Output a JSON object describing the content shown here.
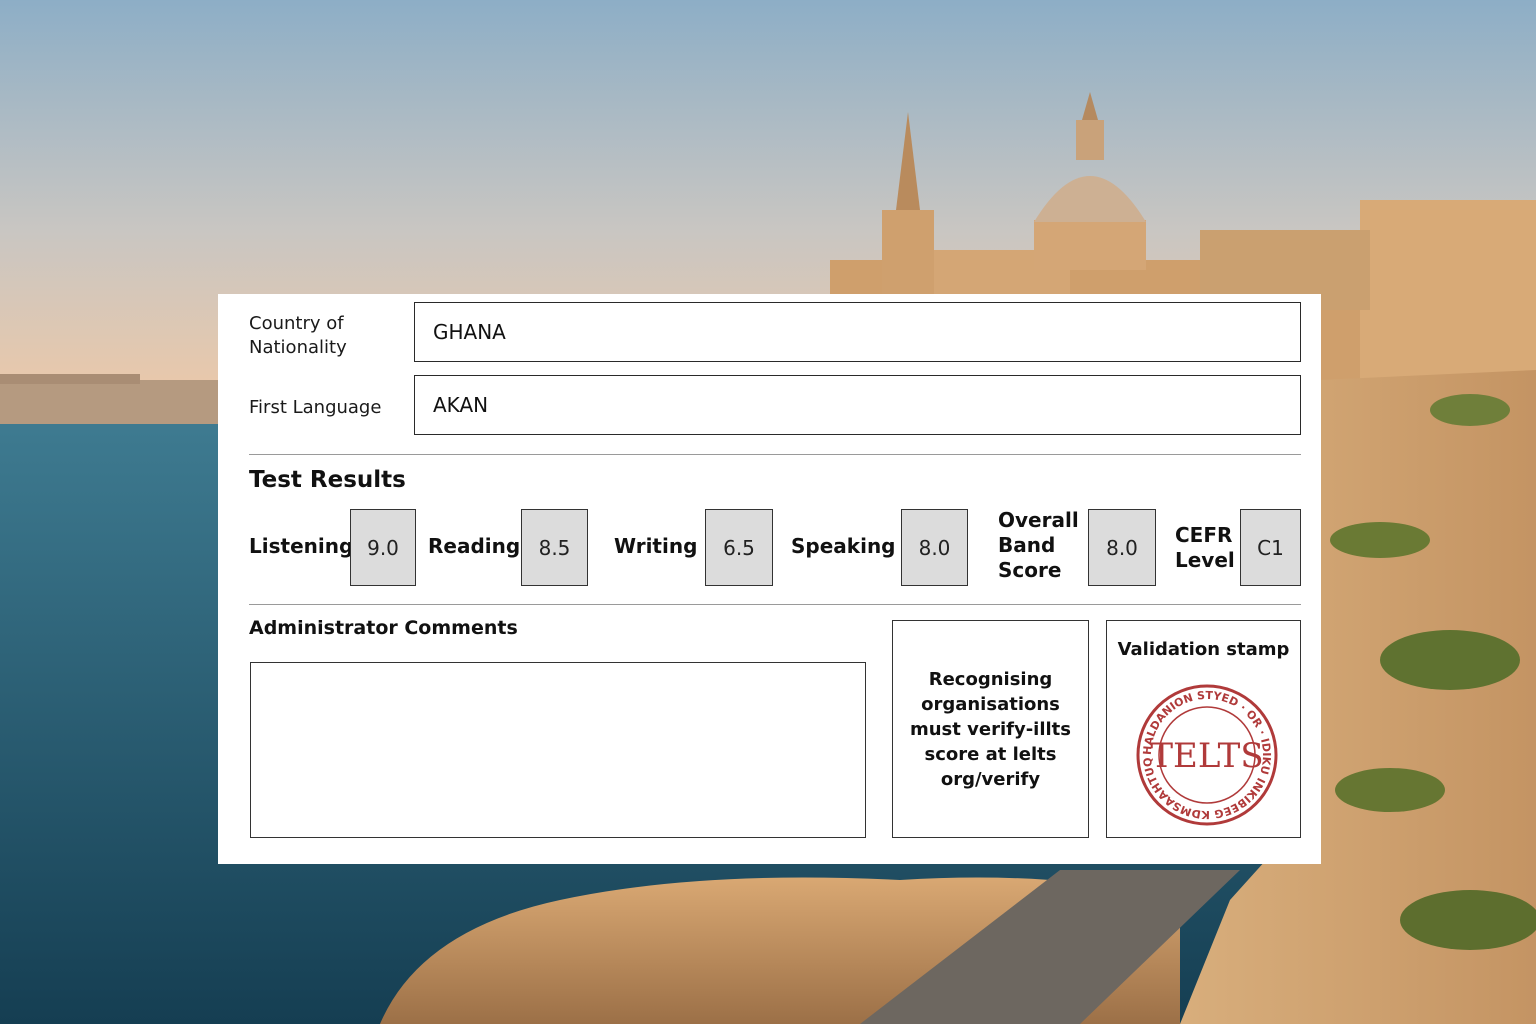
{
  "form": {
    "nationality_label": "Country of Nationality",
    "nationality_value": "GHANA",
    "language_label": "First Language",
    "language_value": "AKAN"
  },
  "results": {
    "heading": "Test Results",
    "listening_label": "Listening",
    "listening_value": "9.0",
    "reading_label": "Reading",
    "reading_value": "8.5",
    "writing_label": "Writing",
    "writing_value": "6.5",
    "speaking_label": "Speaking",
    "speaking_value": "8.0",
    "overall_label": "Overall Band Score",
    "overall_value": "8.0",
    "cefr_label": "CEFR Level",
    "cefr_value": "C1"
  },
  "comments": {
    "heading": "Administrator Comments",
    "value": ""
  },
  "verify": {
    "text": "Recognising organisations must verify-illts score at lelts org/verify"
  },
  "stamp": {
    "title": "Validation stamp",
    "center_text": "TELTS",
    "ring_text": "HALDANION STYED · OR · IDIKU INKIBEEG KDMSAAHTUQ",
    "color": "#b03a3a"
  }
}
